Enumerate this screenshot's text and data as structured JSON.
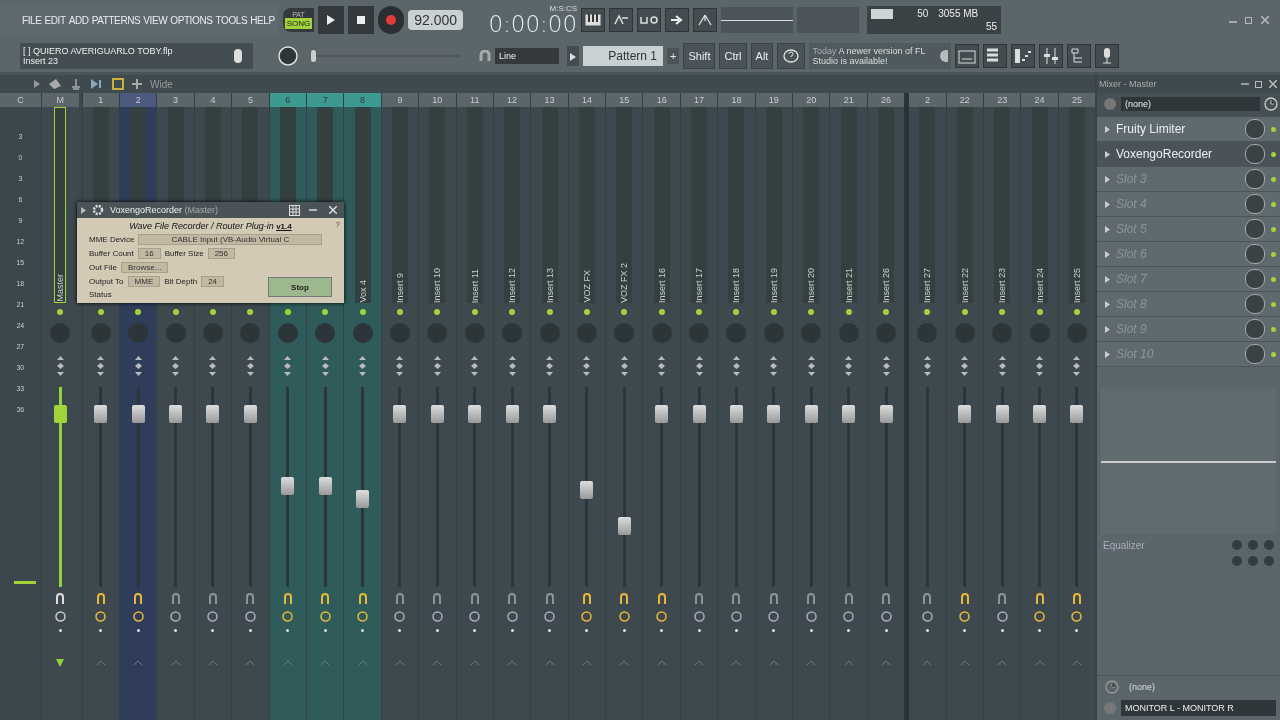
{
  "menu": [
    "FILE",
    "EDIT",
    "ADD",
    "PATTERNS",
    "VIEW",
    "OPTIONS",
    "TOOLS",
    "HELP"
  ],
  "transport": {
    "pat_label": "PAT",
    "song_label": "SONG",
    "song_mode": true,
    "tempo": "92.000",
    "time": "0:00:00",
    "time_unit": "M:S:CS"
  },
  "monitor": {
    "cpu": "50",
    "memory": "3055 MB",
    "polyphony": "55",
    "level": 0.6
  },
  "project": {
    "file": "[  ] QUIERO AVERIGUARLO TOBY.flp",
    "hint": "Insert 23"
  },
  "pitch_slider": {
    "level": 0
  },
  "snap": "Line",
  "pattern": "Pattern 1",
  "pattern_add": "+",
  "modifier_keys": [
    "Shift",
    "Ctrl",
    "Alt"
  ],
  "news": {
    "date": "Today",
    "text": "A newer version of FL Studio is available!"
  },
  "mixer_toolbar": {
    "view": "Wide"
  },
  "scale_header": "C",
  "scale": [
    "3",
    "0",
    "3",
    "6",
    "9",
    "12",
    "15",
    "18",
    "21",
    "24",
    "27",
    "30",
    "33",
    "36"
  ],
  "master": {
    "header": "M",
    "name": "Master",
    "level": 0.9
  },
  "tracks": [
    {
      "number": "1",
      "selected": false,
      "highlighted": false,
      "level": 0.9,
      "routed": true
    },
    {
      "number": "2",
      "selected": false,
      "highlighted": true,
      "level": 0.9,
      "routed": true
    },
    {
      "number": "3",
      "selected": false,
      "highlighted": false,
      "level": 0.9,
      "routed": false
    },
    {
      "number": "4",
      "selected": false,
      "highlighted": false,
      "level": 0.9,
      "routed": false
    },
    {
      "number": "5",
      "selected": false,
      "highlighted": false,
      "level": 0.9,
      "routed": false
    },
    {
      "number": "6",
      "selected": true,
      "highlighted": false,
      "level": 0.5,
      "routed": true
    },
    {
      "number": "7",
      "selected": true,
      "highlighted": false,
      "level": 0.5,
      "routed": true
    },
    {
      "number": "8",
      "name": "Vox 4",
      "selected": true,
      "highlighted": false,
      "level": 0.43,
      "routed": true
    },
    {
      "number": "9",
      "name": "Insert 9",
      "selected": false,
      "highlighted": false,
      "level": 0.9,
      "routed": false
    },
    {
      "number": "10",
      "name": "Insert 10",
      "selected": false,
      "highlighted": false,
      "level": 0.9,
      "routed": false
    },
    {
      "number": "11",
      "name": "Insert 11",
      "selected": false,
      "highlighted": false,
      "level": 0.9,
      "routed": false
    },
    {
      "number": "12",
      "name": "Insert 12",
      "selected": false,
      "highlighted": false,
      "level": 0.9,
      "routed": false
    },
    {
      "number": "13",
      "name": "Insert 13",
      "selected": false,
      "highlighted": false,
      "level": 0.9,
      "routed": false
    },
    {
      "number": "14",
      "name": "VOZ FX",
      "selected": false,
      "highlighted": false,
      "level": 0.48,
      "routed": true
    },
    {
      "number": "15",
      "name": "VOZ FX 2",
      "selected": false,
      "highlighted": false,
      "level": 0.28,
      "routed": true
    },
    {
      "number": "16",
      "name": "Insert 16",
      "selected": false,
      "highlighted": false,
      "level": 0.9,
      "routed": true
    },
    {
      "number": "17",
      "name": "Insert 17",
      "selected": false,
      "highlighted": false,
      "level": 0.9,
      "routed": false
    },
    {
      "number": "18",
      "name": "Insert 18",
      "selected": false,
      "highlighted": false,
      "level": 0.9,
      "routed": false
    },
    {
      "number": "19",
      "name": "Insert 19",
      "selected": false,
      "highlighted": false,
      "level": 0.9,
      "routed": false
    },
    {
      "number": "20",
      "name": "Insert 20",
      "selected": false,
      "highlighted": false,
      "level": 0.9,
      "routed": false
    },
    {
      "number": "21",
      "name": "Insert 21",
      "selected": false,
      "highlighted": false,
      "level": 0.9,
      "routed": false
    },
    {
      "number": "26",
      "name": "Insert 26",
      "selected": false,
      "highlighted": false,
      "level": 0.9,
      "routed": false
    },
    {
      "number": "2",
      "name": "Insert 27",
      "selected": false,
      "highlighted": false,
      "routed": false
    },
    {
      "number": "22",
      "name": "Insert 22",
      "selected": false,
      "highlighted": false,
      "level": 0.9,
      "routed": true
    },
    {
      "number": "23",
      "name": "Insert 23",
      "selected": false,
      "highlighted": false,
      "level": 0.9,
      "routed": false
    },
    {
      "number": "24",
      "name": "Insert 24",
      "selected": false,
      "highlighted": false,
      "level": 0.9,
      "routed": true
    },
    {
      "number": "25",
      "name": "Insert 25",
      "selected": false,
      "highlighted": false,
      "level": 0.9,
      "routed": true
    }
  ],
  "plugin_window": {
    "title": "VoxengoRecorder",
    "target": "(Master)",
    "heading": "Wave File Recorder / Router Plug-in",
    "version": "v1.4",
    "help": "?",
    "device_label": "MME Device",
    "device": "CABLE Input (VB-Audio Virtual C",
    "buffer_count_label": "Buffer Count",
    "buffer_count": "16",
    "buffer_size_label": "Buffer Size",
    "buffer_size": "256",
    "out_file_label": "Out File",
    "browse": "Browse...",
    "output_to_label": "Output To",
    "output_to": "MME",
    "bit_depth_label": "Bit Depth",
    "bit_depth": "24",
    "status_label": "Status",
    "stop": "Stop"
  },
  "panel": {
    "title": "Mixer - Master",
    "input": "(none)",
    "slots": [
      {
        "name": "Fruity Limiter",
        "filled": true,
        "selected": false
      },
      {
        "name": "VoxengoRecorder",
        "filled": true,
        "selected": true
      },
      {
        "name": "Slot 3",
        "filled": false,
        "selected": false
      },
      {
        "name": "Slot 4",
        "filled": false,
        "selected": false
      },
      {
        "name": "Slot 5",
        "filled": false,
        "selected": false
      },
      {
        "name": "Slot 6",
        "filled": false,
        "selected": false
      },
      {
        "name": "Slot 7",
        "filled": false,
        "selected": false
      },
      {
        "name": "Slot 8",
        "filled": false,
        "selected": false
      },
      {
        "name": "Slot 9",
        "filled": false,
        "selected": false
      },
      {
        "name": "Slot 10",
        "filled": false,
        "selected": false
      }
    ],
    "equalizer": "Equalizer",
    "send": "(none)",
    "output": "MONITOR L - MONITOR R"
  }
}
